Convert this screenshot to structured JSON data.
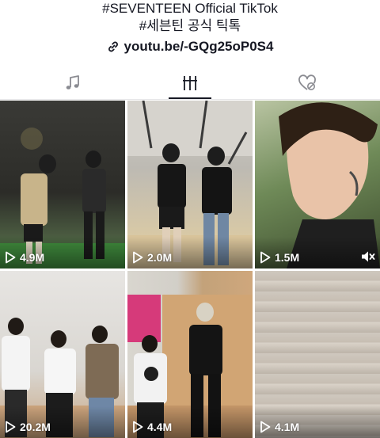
{
  "profile": {
    "bio_line_1": "#SEVENTEEN Official TikTok",
    "bio_line_2": "#세븐틴 공식 틱톡",
    "link_text": "youtu.be/-GQg25oP0S4",
    "link_icon": "link-icon"
  },
  "tabs": [
    {
      "name": "music",
      "icon": "music-note-icon"
    },
    {
      "name": "videos",
      "icon": "grid-bars-icon",
      "active": true
    },
    {
      "name": "liked",
      "icon": "hidden-heart-icon"
    }
  ],
  "videos": [
    {
      "views": "4.9M"
    },
    {
      "views": "2.0M"
    },
    {
      "views": "1.5M",
      "muted": true
    },
    {
      "views": "20.2M"
    },
    {
      "views": "4.4M"
    },
    {
      "views": "4.1M"
    }
  ],
  "colors": {
    "text": "#161823",
    "divider": "#e6e6e8",
    "overlay_text": "#ffffff"
  }
}
